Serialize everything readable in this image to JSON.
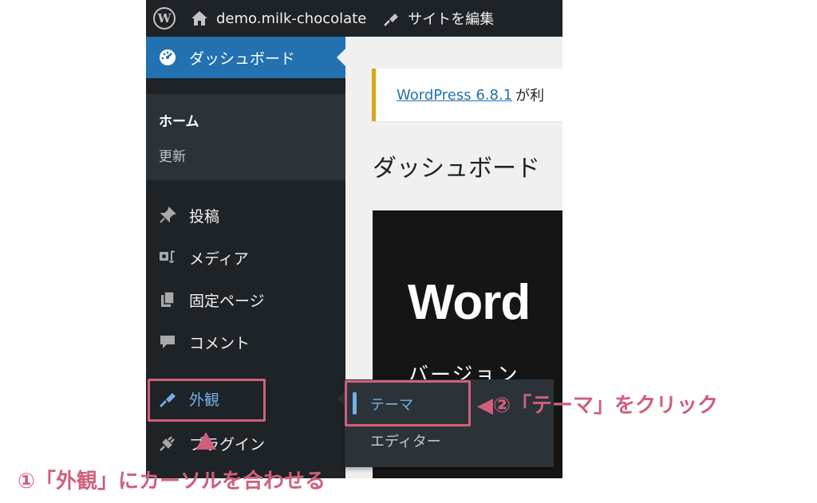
{
  "admin_bar": {
    "site_name": "demo.milk-chocolate",
    "edit_site": "サイトを編集"
  },
  "sidebar": {
    "dashboard": "ダッシュボード",
    "sub_home": "ホーム",
    "sub_updates": "更新",
    "items": [
      {
        "label": "投稿",
        "icon": "pin-icon"
      },
      {
        "label": "メディア",
        "icon": "media-icon"
      },
      {
        "label": "固定ページ",
        "icon": "pages-icon"
      },
      {
        "label": "コメント",
        "icon": "comment-icon"
      },
      {
        "label": "外観",
        "icon": "brush-icon"
      },
      {
        "label": "プラグイン",
        "icon": "plugin-icon"
      }
    ]
  },
  "main": {
    "notice_link": "WordPress 6.8.1",
    "notice_text": "が利",
    "page_title": "ダッシュボード",
    "welcome_big": "Word",
    "welcome_sub": "バージョン"
  },
  "flyout": {
    "items": [
      "テーマ",
      "エディター"
    ]
  },
  "annotations": {
    "step1": "①「外観」にカーソルを合わせる",
    "step2": "◀②「テーマ」をクリック",
    "color": "#d15f7c"
  },
  "colors": {
    "admin_dark": "#1d2327",
    "submenu_bg": "#2c3338",
    "highlight": "#2271b1",
    "hover_text": "#72aee6",
    "notice_border": "#dba617"
  }
}
